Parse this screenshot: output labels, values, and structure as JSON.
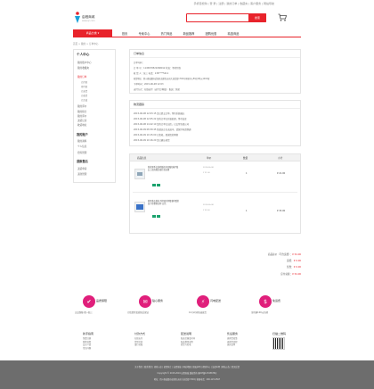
{
  "topbar": {
    "links": "手机轻松购 | 登 录 | 注册 | 我的订单 | 收藏夹 | 客户服务 | 网站导航"
  },
  "logo": {
    "name": "启程商城",
    "sub": "www.qc.com"
  },
  "search": {
    "placeholder": "",
    "button": "搜索"
  },
  "nav": {
    "all_categories": "商品分类 ▾",
    "items": [
      "首页",
      "专卖中心",
      "热门商品",
      "新品推荐",
      "团购优惠",
      "精选商品"
    ]
  },
  "breadcrumb": "首页 > 我的 > 订单中心",
  "sidebar": {
    "title": "个人中心",
    "sections": [
      {
        "label": "我的账户中心",
        "items": [
          "我的收藏夹"
        ]
      },
      {
        "label": "我的订单",
        "items": [
          "已付款",
          "待付款",
          "已发货",
          "已收货",
          "已完成"
        ]
      },
      {
        "label": "我的评价",
        "items": [
          "我的积分",
          "我的评价",
          "退货记录",
          "收货地址"
        ]
      }
    ],
    "account_title": "我的账户",
    "account_items": [
      "我的资料",
      "个人信息",
      "密码管理"
    ],
    "extra_title": "退款售后",
    "extra_items": [
      "退货申请",
      "退款管理"
    ]
  },
  "order_info": {
    "title": "订单信息",
    "rows": [
      "订单号码：",
      "订 单 号：1145678521068012        状态：等待付款",
      "收 货 人：张三  电话：136****5211",
      "收货地址：四川省成都市武侯区高新区天府大道北段1700号环球中心E1区2单元1001室",
      "下单时间：2015-06-08 12:03",
      "支付方式：在线支付（支付宝/网银）  配送：快递"
    ]
  },
  "logistics": {
    "title": "物流跟踪",
    "rows": [
      "2015-06-08 12:03:15  您已提交订单，等待系统确认",
      "2015-06-08 12:05:22  您的订单已开始处理，等待出库",
      "2015-06-08 14:22:10  您的订单已出库，已交付快递公司",
      "2015-06-09 08:30:45  快递员正在派送中，请保持电话畅通",
      "2015-06-09 10:15:00  已签收，感谢您的购物",
      "2015-06-09 10:16:20  您已确认收货"
    ]
  },
  "order_items": {
    "headers": [
      "商品信息",
      "单价",
      "数量",
      "小计"
    ],
    "products": [
      {
        "name": "新款夏季女装韩版修身显瘦短袖T恤女上衣纯棉百搭打底衫潮",
        "date": "2015-06-08",
        "price": "¥ 21.00",
        "qty": "1",
        "subtotal": "¥ 21.00"
      },
      {
        "name": "家用多功能电子秤厨房秤精准称重烘焙小型食物克称 白色",
        "date": "2015-06-08",
        "price": "¥ 33.00",
        "qty": "1",
        "subtotal": "¥ 33.00"
      }
    ]
  },
  "summary": {
    "rows": [
      {
        "label": "商品总价（不含运费）：",
        "value": "¥ 54.00"
      },
      {
        "label": "运费：",
        "value": "¥ 0.00"
      },
      {
        "label": "优惠：",
        "value": "¥ 0.00"
      },
      {
        "label": "应付总额：",
        "value": "¥ 54.00"
      }
    ]
  },
  "features": [
    {
      "title": "品质保障",
      "sub": "正品保障 假一赔三",
      "icon": "bag-icon",
      "glyph": "✔"
    },
    {
      "title": "贴心服务",
      "sub": "为您提供优质售后保证",
      "icon": "chat-icon",
      "glyph": "✉"
    },
    {
      "title": "闪电配送",
      "sub": "12小时内快速发货",
      "icon": "lightning-icon",
      "glyph": "⚡"
    },
    {
      "title": "免运费",
      "sub": "全场满100元包邮",
      "icon": "truck-icon",
      "glyph": "$"
    }
  ],
  "footer_cols": [
    {
      "title": "新手指南",
      "items": [
        "免费注册",
        "购物流程",
        "会员介绍",
        "常见问题"
      ]
    },
    {
      "title": "付款方式",
      "items": [
        "在线支付",
        "货到付款",
        "银行转账"
      ]
    },
    {
      "title": "配送说明",
      "items": [
        "配送范围及时间",
        "配送费用说明",
        "验货与签收"
      ]
    },
    {
      "title": "售后服务",
      "items": [
        "退换货政策",
        "退换货流程",
        "退款说明"
      ]
    },
    {
      "title": "扫描二维码",
      "items": []
    }
  ],
  "footer_lines": [
    "关于我们 | 联系我们 | 商家入驻 | 招贤纳士 | 友情链接 | 网站地图 | 隐私声明 | 帮助中心 | 法律声明 | 网站公告 | 意见反馈",
    "Copyright © 2015-2016 启程商城 版权所有  蜀ICP备12345678号",
    "地址：四川省成都市高新区天府大道北段1700号 客服电话：400-123-4567"
  ],
  "colors": {
    "accent": "#e8232b",
    "feature": "#e01f7b",
    "footer": "#6d6d6d"
  }
}
